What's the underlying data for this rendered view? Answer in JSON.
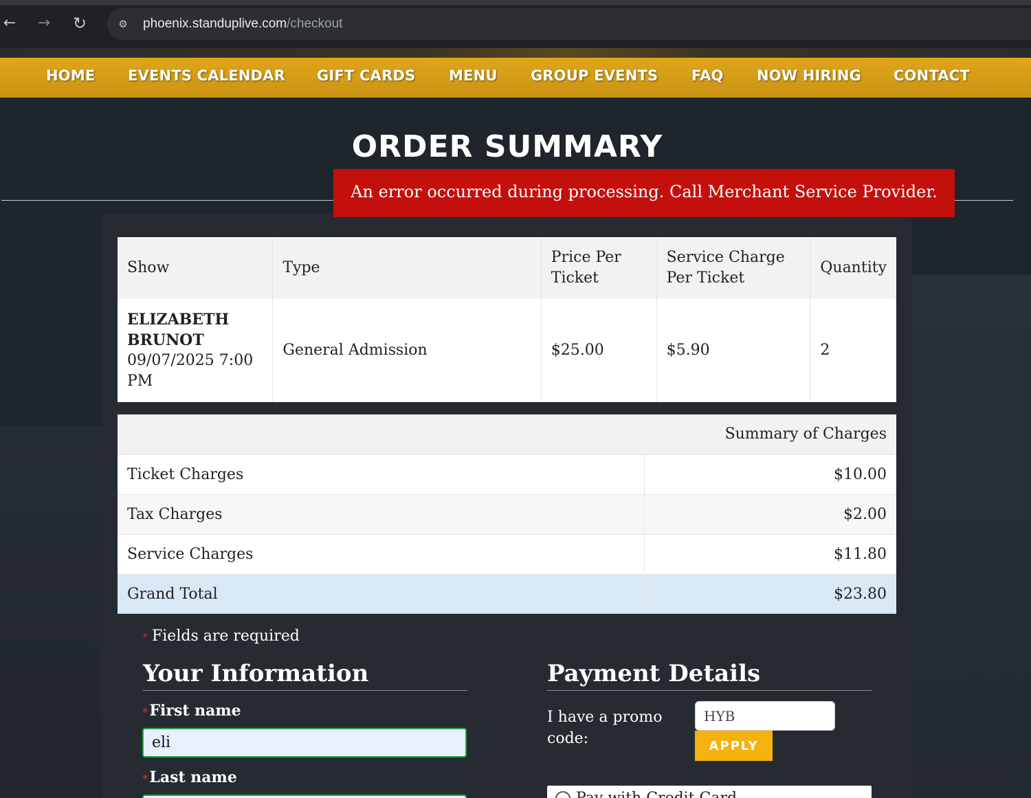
{
  "browser": {
    "url_host": "phoenix.standuplive.com",
    "url_path": "/checkout",
    "back_icon": "←",
    "forward_icon": "→",
    "reload_icon": "↻",
    "site_info_icon": "⚙"
  },
  "nav": {
    "items": [
      "HOME",
      "EVENTS CALENDAR",
      "GIFT CARDS",
      "MENU",
      "GROUP EVENTS",
      "FAQ",
      "NOW HIRING",
      "CONTACT"
    ]
  },
  "page": {
    "title": "ORDER SUMMARY",
    "error": "An error occurred during processing. Call Merchant Service Provider."
  },
  "order_table": {
    "headers": [
      "Show",
      "Type",
      "Price Per Ticket",
      "Service Charge Per Ticket",
      "Quantity"
    ],
    "rows": [
      {
        "show_name": "ELIZABETH BRUNOT",
        "show_date": "09/07/2025 7:00 PM",
        "type": "General Admission",
        "price": "$25.00",
        "service_charge": "$5.90",
        "quantity": "2"
      }
    ]
  },
  "summary": {
    "header": "Summary of Charges",
    "rows": [
      {
        "label": "Ticket Charges",
        "amount": "$10.00"
      },
      {
        "label": "Tax Charges",
        "amount": "$2.00"
      },
      {
        "label": "Service Charges",
        "amount": "$11.80"
      },
      {
        "label": "Grand Total",
        "amount": "$23.80"
      }
    ]
  },
  "form": {
    "required_note": "Fields are required",
    "required_star": "*",
    "your_info_heading": "Your Information",
    "payment_heading": "Payment Details",
    "first_name_label": "First name",
    "first_name_value": "eli",
    "last_name_label": "Last name",
    "promo_label": "I have a promo code:",
    "promo_value": "HYB",
    "apply_label": "APPLY",
    "credit_card_label": "Pay with Credit Card"
  },
  "colors": {
    "nav_bar": "#e0a619",
    "error_bg": "#c4100d",
    "apply_bg": "#f5b10d",
    "grand_total_bg": "#d9e8f5",
    "valid_border": "#28a745"
  }
}
